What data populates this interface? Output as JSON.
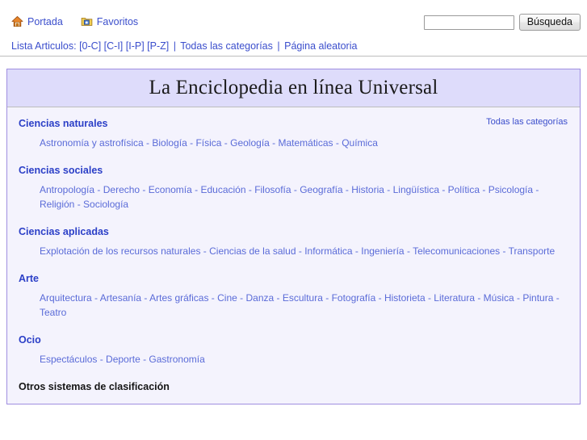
{
  "toolbar": {
    "links": [
      {
        "label": "Portada",
        "icon": "home-icon"
      },
      {
        "label": "Favoritos",
        "icon": "folder-star-icon"
      }
    ],
    "search": {
      "value": "",
      "placeholder": "",
      "button_label": "Búsqueda"
    }
  },
  "navstrip": {
    "lead": "Lista Articulos:",
    "ranges": [
      "[0-C]",
      "[C-I]",
      "[I-P]",
      "[P-Z]"
    ],
    "separator": "|",
    "all_categories": "Todas las categorías",
    "random_page": "Página aleatoria"
  },
  "header": {
    "title": "La Enciclopedia en línea Universal"
  },
  "content": {
    "all_categories_link": "Todas las categorías",
    "sections": [
      {
        "heading": "Ciencias naturales",
        "heading_style": "link",
        "items": [
          "Astronomía y astrofísica",
          "Biología",
          "Física",
          "Geología",
          "Matemáticas",
          "Química"
        ]
      },
      {
        "heading": "Ciencias sociales",
        "heading_style": "link",
        "items": [
          "Antropología",
          "Derecho",
          "Economía",
          "Educación",
          "Filosofía",
          "Geografía",
          "Historia",
          "Lingüística",
          "Política",
          "Psicología",
          "Religión",
          "Sociología"
        ]
      },
      {
        "heading": "Ciencias aplicadas",
        "heading_style": "link",
        "items": [
          "Explotación de los recursos naturales",
          "Ciencias de la salud",
          "Informática",
          "Ingeniería",
          "Telecomunicaciones",
          "Transporte"
        ]
      },
      {
        "heading": "Arte",
        "heading_style": "link",
        "items": [
          "Arquitectura",
          "Artesanía",
          "Artes gráficas",
          "Cine",
          "Danza",
          "Escultura",
          "Fotografía",
          "Historieta",
          "Literatura",
          "Música",
          "Pintura",
          "Teatro"
        ]
      },
      {
        "heading": "Ocio",
        "heading_style": "link",
        "items": [
          "Espectáculos",
          "Deporte",
          "Gastronomía"
        ]
      },
      {
        "heading": "Otros sistemas de clasificación",
        "heading_style": "plain",
        "items": []
      }
    ]
  },
  "colors": {
    "link": "#3b4ecc",
    "item_link": "#5a6bd8",
    "heading": "#2b3fc7",
    "box_border": "#9f8ee0",
    "banner_bg": "#dedcfb",
    "body_bg": "#f4f3fd"
  }
}
